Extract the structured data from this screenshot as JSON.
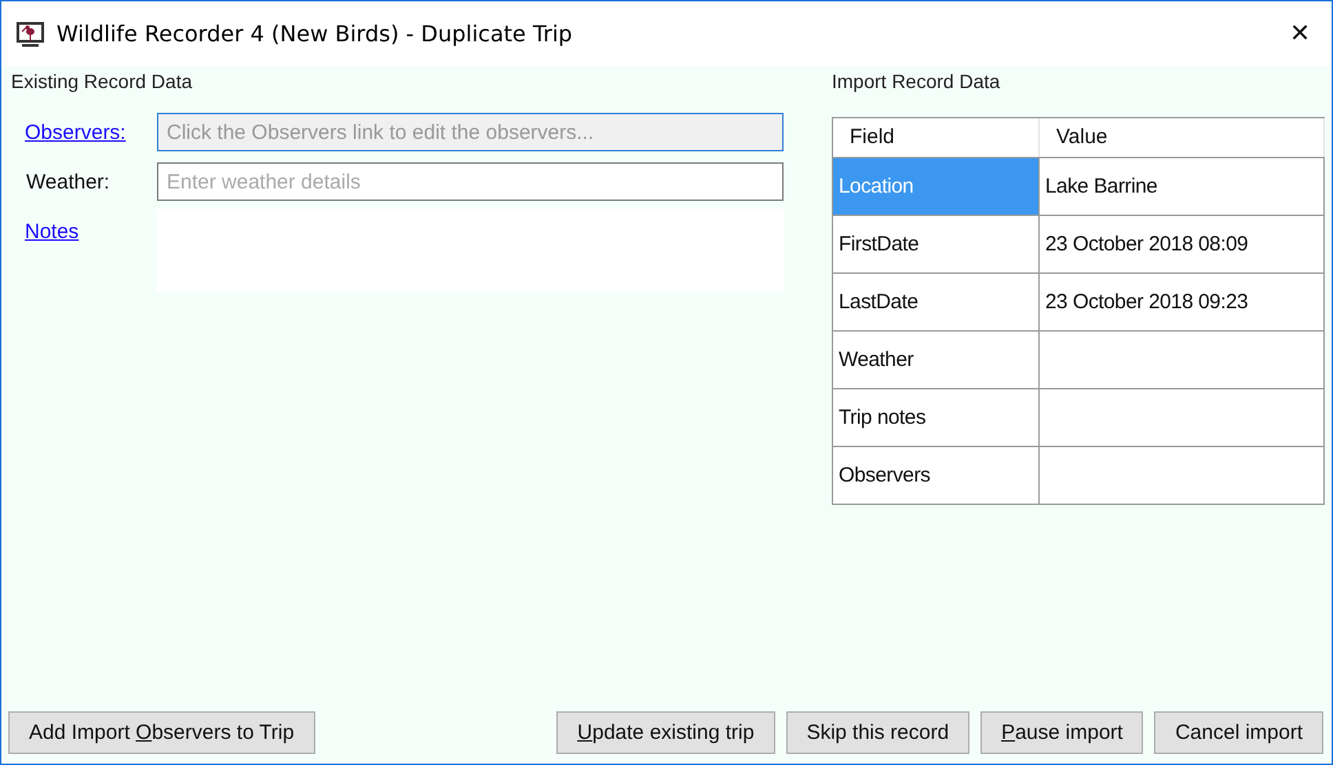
{
  "window": {
    "title": "Wildlife Recorder 4 (New Birds) - Duplicate Trip",
    "close": "✕"
  },
  "existing": {
    "heading": "Existing Record Data",
    "fields": [
      {
        "kind": "link",
        "label": "Observers:",
        "placeholder": "Click the Observers link to edit the observers...",
        "focused": true,
        "disabled": true
      },
      {
        "kind": "label",
        "label": "Weather:",
        "placeholder": "Enter weather details",
        "focused": false,
        "disabled": false
      },
      {
        "kind": "notes",
        "label": "Notes"
      }
    ]
  },
  "import": {
    "heading": "Import Record Data",
    "columns": [
      "Field",
      "Value"
    ],
    "rows": [
      {
        "field": "Location",
        "value": "Lake Barrine",
        "selected": true
      },
      {
        "field": "FirstDate",
        "value": "23 October 2018 08:09",
        "selected": false
      },
      {
        "field": "LastDate",
        "value": "23 October 2018 09:23",
        "selected": false
      },
      {
        "field": "Weather",
        "selected": false
      },
      {
        "field": "Trip notes",
        "selected": false
      },
      {
        "field": "Observers",
        "selected": false
      }
    ]
  },
  "left_buttons": [
    {
      "before": "Add Import ",
      "access_key": "O",
      "after": "bservers to Trip"
    }
  ],
  "right_buttons": [
    {
      "access_key": "U",
      "after": "pdate existing trip"
    },
    {
      "before": "Skip this record"
    },
    {
      "access_key": "P",
      "after": "ause import"
    },
    {
      "before": "Cancel import"
    }
  ]
}
